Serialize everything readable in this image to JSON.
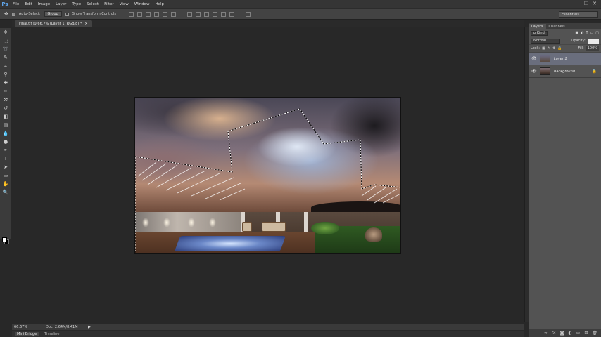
{
  "app": {
    "logo": "Ps"
  },
  "menu": [
    "File",
    "Edit",
    "Image",
    "Layer",
    "Type",
    "Select",
    "Filter",
    "View",
    "Window",
    "Help"
  ],
  "window_controls": [
    "–",
    "❐",
    "✕"
  ],
  "options_bar": {
    "auto_select_label": "Auto-Select:",
    "auto_select_checked": true,
    "auto_select_target": "Group",
    "transform_label": "Show Transform Controls",
    "transform_checked": false
  },
  "workspace": {
    "label": "Essentials"
  },
  "document_tab": {
    "title": "Final.tif @ 66.7% (Layer 1, RGB/8) *",
    "close": "×"
  },
  "status_bar": {
    "zoom": "66.67%",
    "doc_info": "Doc: 2.64M/8.41M",
    "arrow": "▶"
  },
  "bottom_tabs": [
    "Mini Bridge",
    "Timeline"
  ],
  "layers_panel": {
    "tabs": [
      "Layers",
      "Channels"
    ],
    "kind_label": "ρ Kind",
    "blend_mode": "Normal",
    "opacity_label": "Opacity:",
    "lock_label": "Lock:",
    "fill_label": "Fill:",
    "fill_value": "100%",
    "layers": [
      {
        "name": "Layer 1",
        "selected": true,
        "visible": true
      },
      {
        "name": "Background",
        "selected": false,
        "visible": true,
        "locked": true
      }
    ]
  },
  "colors": {
    "accent_ps": "#5fa4e8",
    "selected_layer": "#6a6e7d"
  },
  "icons": [
    "move-tool-icon",
    "eye-icon",
    "lock-icon",
    "new-layer-icon",
    "trash-icon"
  ]
}
